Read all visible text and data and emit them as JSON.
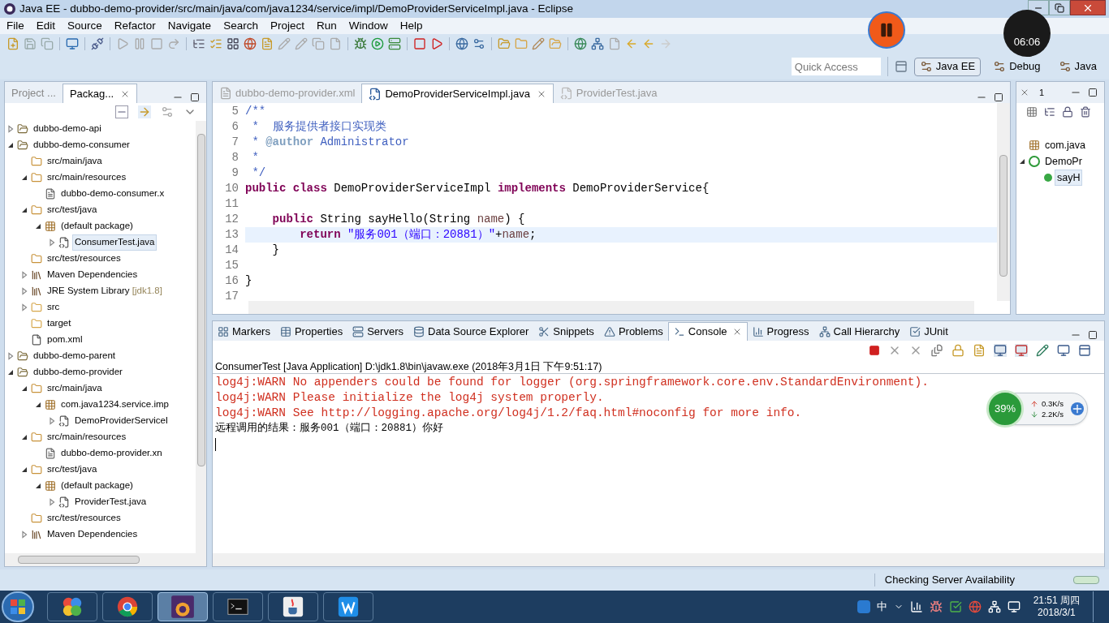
{
  "window": {
    "title": "Java EE - dubbo-demo-provider/src/main/java/com/java1234/service/impl/DemoProviderServiceImpl.java - Eclipse"
  },
  "menu": [
    "File",
    "Edit",
    "Source",
    "Refactor",
    "Navigate",
    "Search",
    "Project",
    "Run",
    "Window",
    "Help"
  ],
  "recording": {
    "timer": "06:06"
  },
  "quick_access": {
    "placeholder": "Quick Access"
  },
  "perspectives": [
    {
      "label": "Java EE",
      "selected": true
    },
    {
      "label": "Debug",
      "selected": false
    },
    {
      "label": "Java",
      "selected": false
    }
  ],
  "left_panel": {
    "tabs": [
      {
        "label": "Project ...",
        "selected": false
      },
      {
        "label": "Packag...",
        "selected": true
      }
    ],
    "tree": [
      {
        "label": "dubbo-demo-api",
        "kind": "project",
        "expanded": false,
        "selected": false
      },
      {
        "label": "dubbo-demo-consumer",
        "kind": "project",
        "expanded": true,
        "selected": false,
        "children": [
          {
            "label": "src/main/java",
            "kind": "srcfolder",
            "selected": false
          },
          {
            "label": "src/main/resources",
            "kind": "srcfolder",
            "expanded": true,
            "selected": false,
            "children": [
              {
                "label": "dubbo-demo-consumer.x",
                "kind": "xml",
                "selected": false
              }
            ]
          },
          {
            "label": "src/test/java",
            "kind": "srcfolder",
            "expanded": true,
            "selected": false,
            "children": [
              {
                "label": "(default package)",
                "kind": "package",
                "expanded": true,
                "selected": false,
                "children": [
                  {
                    "label": "ConsumerTest.java",
                    "kind": "java",
                    "expanded": false,
                    "selected": true
                  }
                ]
              }
            ]
          },
          {
            "label": "src/test/resources",
            "kind": "srcfolder",
            "selected": false
          },
          {
            "label": "Maven Dependencies",
            "kind": "library",
            "expanded": false,
            "selected": false
          },
          {
            "label": "JRE System Library",
            "decoration": "[jdk1.8]",
            "kind": "library",
            "expanded": false,
            "selected": false
          },
          {
            "label": "src",
            "kind": "folder",
            "expanded": false,
            "selected": false
          },
          {
            "label": "target",
            "kind": "folder",
            "selected": false
          },
          {
            "label": "pom.xml",
            "kind": "pom",
            "selected": false
          }
        ]
      },
      {
        "label": "dubbo-demo-parent",
        "kind": "project",
        "expanded": false,
        "selected": false
      },
      {
        "label": "dubbo-demo-provider",
        "kind": "project",
        "expanded": true,
        "selected": false,
        "children": [
          {
            "label": "src/main/java",
            "kind": "srcfolder",
            "expanded": true,
            "selected": false,
            "children": [
              {
                "label": "com.java1234.service.imp",
                "kind": "package",
                "expanded": true,
                "selected": false,
                "children": [
                  {
                    "label": "DemoProviderServiceI",
                    "kind": "java",
                    "expanded": false,
                    "selected": false
                  }
                ]
              }
            ]
          },
          {
            "label": "src/main/resources",
            "kind": "srcfolder",
            "expanded": true,
            "selected": false,
            "children": [
              {
                "label": "dubbo-demo-provider.xn",
                "kind": "xml",
                "selected": false
              }
            ]
          },
          {
            "label": "src/test/java",
            "kind": "srcfolder",
            "expanded": true,
            "selected": false,
            "children": [
              {
                "label": "(default package)",
                "kind": "package",
                "expanded": true,
                "selected": false,
                "children": [
                  {
                    "label": "ProviderTest.java",
                    "kind": "java",
                    "expanded": false,
                    "selected": false
                  }
                ]
              }
            ]
          },
          {
            "label": "src/test/resources",
            "kind": "srcfolder",
            "selected": false
          },
          {
            "label": "Maven Dependencies",
            "kind": "library",
            "expanded": false,
            "selected": false
          }
        ]
      }
    ]
  },
  "editor": {
    "tabs": [
      {
        "label": "dubbo-demo-provider.xml",
        "kind": "xml",
        "selected": false
      },
      {
        "label": "DemoProviderServiceImpl.java",
        "kind": "java",
        "selected": true
      },
      {
        "label": "ProviderTest.java",
        "kind": "java",
        "selected": false
      }
    ],
    "lines": [
      {
        "number": "5",
        "current": false,
        "tokens": [
          {
            "kind": "comment",
            "text": "/**"
          }
        ]
      },
      {
        "number": "6",
        "current": false,
        "tokens": [
          {
            "kind": "comment",
            "text": " *  服务提供者接口实现类"
          }
        ]
      },
      {
        "number": "7",
        "current": false,
        "tokens": [
          {
            "kind": "comment",
            "text": " * "
          },
          {
            "kind": "tag",
            "text": "@author"
          },
          {
            "kind": "comment",
            "text": " Administrator"
          }
        ]
      },
      {
        "number": "8",
        "current": false,
        "tokens": [
          {
            "kind": "comment",
            "text": " *"
          }
        ]
      },
      {
        "number": "9",
        "current": false,
        "tokens": [
          {
            "kind": "comment",
            "text": " */"
          }
        ]
      },
      {
        "number": "10",
        "current": false,
        "tokens": [
          {
            "kind": "keyword",
            "text": "public class"
          },
          {
            "kind": "plain",
            "text": " DemoProviderServiceImpl "
          },
          {
            "kind": "keyword",
            "text": "implements"
          },
          {
            "kind": "plain",
            "text": " DemoProviderService{"
          }
        ]
      },
      {
        "number": "11",
        "current": false
      },
      {
        "number": "12",
        "current": false,
        "tokens": [
          {
            "kind": "keyword",
            "text": "    public"
          },
          {
            "kind": "plain",
            "text": " String sayHello(String "
          },
          {
            "kind": "param",
            "text": "name"
          },
          {
            "kind": "plain",
            "text": ") {"
          }
        ]
      },
      {
        "number": "13",
        "current": true,
        "tokens": [
          {
            "kind": "keyword",
            "text": "        return"
          },
          {
            "kind": "string",
            "text": " \"服务001（端口：20881）\""
          },
          {
            "kind": "plain",
            "text": "+"
          },
          {
            "kind": "param",
            "text": "name"
          },
          {
            "kind": "plain",
            "text": ";"
          }
        ]
      },
      {
        "number": "14",
        "current": false,
        "tokens": [
          {
            "kind": "plain",
            "text": "    }"
          }
        ]
      },
      {
        "number": "15",
        "current": false
      },
      {
        "number": "16",
        "current": false,
        "tokens": [
          {
            "kind": "plain",
            "text": "}"
          }
        ]
      },
      {
        "number": "17",
        "current": false
      }
    ]
  },
  "outline": {
    "hidden_views": "1",
    "items": [
      {
        "label": "com.java",
        "kind": "import",
        "selected": false
      },
      {
        "label": "DemoPr",
        "kind": "class",
        "expanded": true,
        "selected": false,
        "children": [
          {
            "label": "sayH",
            "kind": "method",
            "selected": true
          }
        ]
      }
    ]
  },
  "console": {
    "tabs": [
      {
        "label": "Markers",
        "selected": false
      },
      {
        "label": "Properties",
        "selected": false
      },
      {
        "label": "Servers",
        "selected": false
      },
      {
        "label": "Data Source Explorer",
        "selected": false
      },
      {
        "label": "Snippets",
        "selected": false
      },
      {
        "label": "Problems",
        "selected": false
      },
      {
        "label": "Console",
        "selected": true
      },
      {
        "label": "Progress",
        "selected": false
      },
      {
        "label": "Call Hierarchy",
        "selected": false
      },
      {
        "label": "JUnit",
        "selected": false
      }
    ],
    "description": "ConsumerTest [Java Application] D:\\jdk1.8\\bin\\javaw.exe (2018年3月1日 下午9:51:17)",
    "lines": [
      {
        "kind": "error",
        "text": "log4j:WARN No appenders could be found for logger (org.springframework.core.env.StandardEnvironment)."
      },
      {
        "kind": "error",
        "text": "log4j:WARN Please initialize the log4j system properly."
      },
      {
        "kind": "error",
        "text": "log4j:WARN See http://logging.apache.org/log4j/1.2/faq.html#noconfig for more info."
      },
      {
        "kind": "output",
        "text": "远程调用的结果：服务001（端口：20881）你好"
      }
    ]
  },
  "network_widget": {
    "percent": "39%",
    "upload": "0.3K/s",
    "download": "2.2K/s"
  },
  "status_bar": {
    "message": "Checking Server Availability"
  },
  "taskbar": {
    "apps": [
      {
        "kind": "pinwheel",
        "selected": false
      },
      {
        "kind": "chrome",
        "selected": false
      },
      {
        "kind": "eclipse",
        "selected": true
      },
      {
        "kind": "terminal",
        "selected": false
      },
      {
        "kind": "java",
        "selected": false
      },
      {
        "kind": "writer",
        "selected": false
      }
    ],
    "input_method": "中",
    "time": "21:51 周四",
    "date": "2018/3/1"
  }
}
